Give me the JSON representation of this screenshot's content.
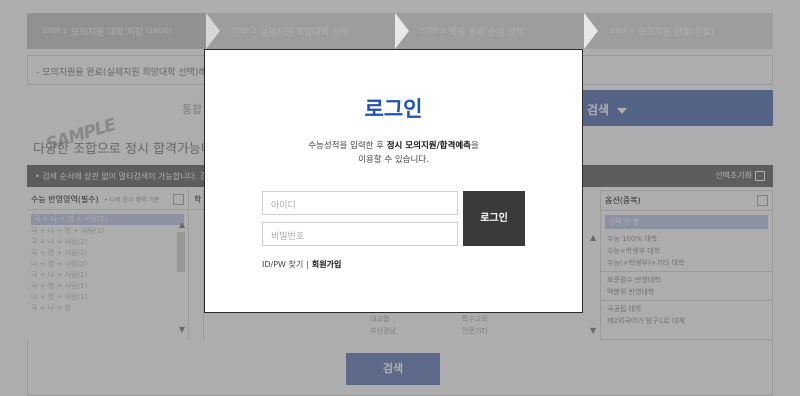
{
  "steps": [
    {
      "num": "STEP 1",
      "label": "모의지원 대학 저장",
      "count": "(16/20)"
    },
    {
      "num": "STEP 2",
      "label": "실제지원 희망대학 선택"
    },
    {
      "num": "STEP 3",
      "label": "희망 등록 순위 선택"
    },
    {
      "num": "STEP 4",
      "label": "모의지원 완료(무료)"
    }
  ],
  "notice": "- 모의지원을 완료(실제지원 희망대학 선택)해",
  "tabs": {
    "integrated": "통합",
    "search": "검색"
  },
  "watermark": "SAMPLE",
  "subtitle": "다양한 조합으로 정시 합격가능대",
  "filter": {
    "text": "• 검색 순서에 상관 없이 멀티검색이 가능합니다. 검",
    "reset": "선택초기화"
  },
  "col1": {
    "title": "수능 반영영역(필수)",
    "hint": "• 나의 응시 영역 기준",
    "items": [
      "국 + 나 + 영 + 사탐(2)",
      "국 + 나 + 영 + 사탐(1)",
      "국 + 나 + 사탐(2)",
      "국 + 영 + 사탐(2)",
      "나 + 영 + 사탐(2)",
      "국 + 나 + 사탐(1)",
      "국 + 영 + 사탐(1)",
      "나 + 영 + 사탐(1)",
      "국 + 나 + 영"
    ]
  },
  "col2": {
    "title": "학"
  },
  "mid": {
    "left": [
      "대교협",
      "부산경남"
    ],
    "right": [
      "특수교육",
      "인문기타"
    ]
  },
  "col4": {
    "title": "옵션(중복)",
    "selected": "선택 안 함",
    "groups": [
      [
        "수능 100% 대학",
        "수능+학생부 대학",
        "수능(+학생부)+기타 대학"
      ],
      [
        "표준점수 반영대학",
        "백분위 반영대학"
      ],
      [
        "국공립 대학",
        "제2외국어가 탐구1로 대체"
      ]
    ]
  },
  "search_button": "검색",
  "modal": {
    "title": "로그인",
    "desc_pre": "수능성적을 입력한 후 ",
    "desc_bold": "정시 모의지원/합격예측",
    "desc_post": "을",
    "desc_line2": "이용할 수 있습니다.",
    "id_placeholder": "아이디",
    "pw_placeholder": "비밀번호",
    "login_button": "로그인",
    "find_link": "ID/PW 찾기",
    "separator": "|",
    "signup_link": "회원가입"
  }
}
